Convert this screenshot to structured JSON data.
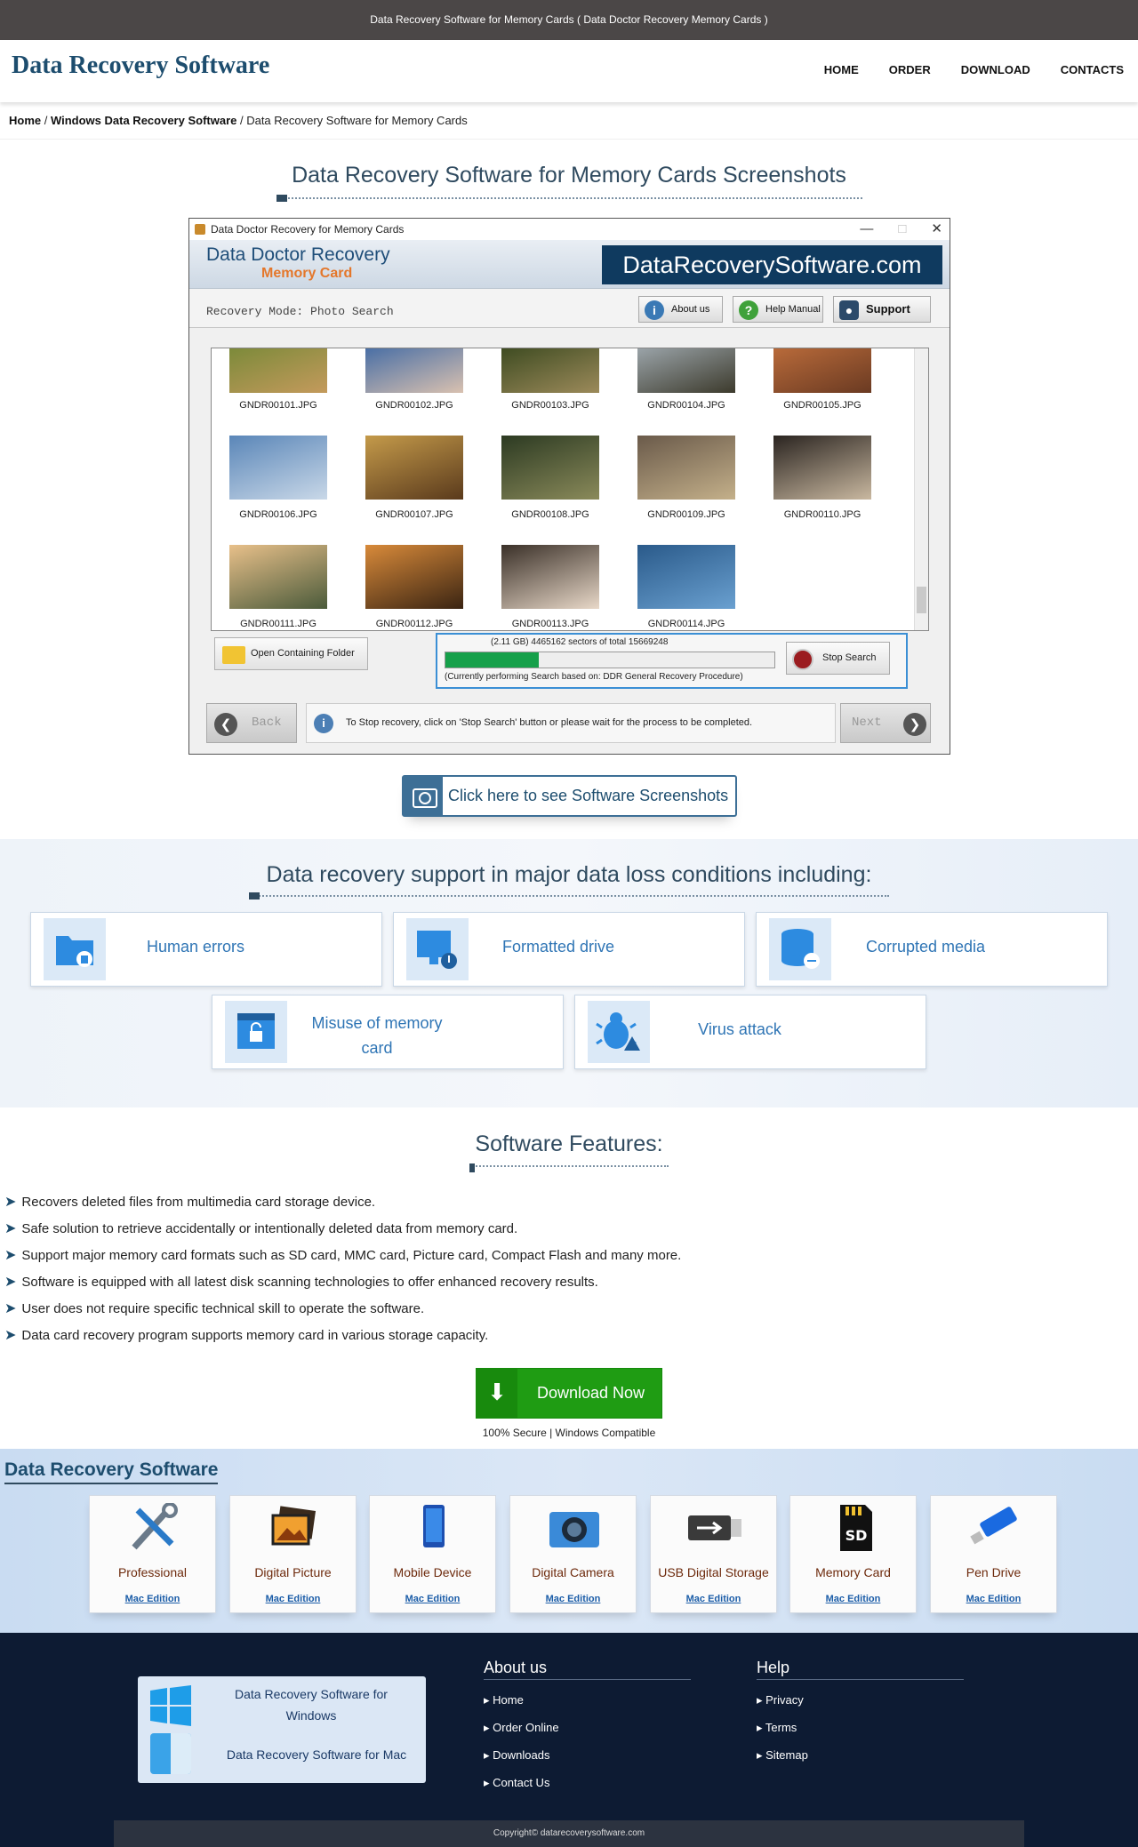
{
  "topbar": {
    "text": "Data Recovery Software for Memory Cards ( Data Doctor Recovery Memory Cards )"
  },
  "header": {
    "logo": "Data Recovery Software",
    "nav": [
      "HOME",
      "ORDER",
      "DOWNLOAD",
      "CONTACTS"
    ]
  },
  "breadcrumb": {
    "home": "Home",
    "sep": " / ",
    "parent": "Windows Data Recovery Software",
    "current": "Data Recovery Software for Memory Cards"
  },
  "screens": {
    "title": "Data Recovery Software for Memory Cards Screenshots",
    "button": "Click here to see Software Screenshots"
  },
  "app": {
    "window_title": "Data Doctor Recovery for Memory Cards",
    "banner_title": "Data Doctor Recovery",
    "banner_sub": "Memory Card",
    "brand": "DataRecoverySoftware.com",
    "mode": "Recovery Mode: Photo Search",
    "about": "About us",
    "help": "Help Manual",
    "support": "Support",
    "files": [
      "GNDR00101.JPG",
      "GNDR00102.JPG",
      "GNDR00103.JPG",
      "GNDR00104.JPG",
      "GNDR00105.JPG",
      "GNDR00106.JPG",
      "GNDR00107.JPG",
      "GNDR00108.JPG",
      "GNDR00109.JPG",
      "GNDR00110.JPG",
      "GNDR00111.JPG",
      "GNDR00112.JPG",
      "GNDR00113.JPG",
      "GNDR00114.JPG"
    ],
    "thumb_colors": [
      [
        "#7c8a3a",
        "#c49a5c"
      ],
      [
        "#4a6fa5",
        "#d9c1b0"
      ],
      [
        "#3f4c22",
        "#9c8a5a"
      ],
      [
        "#9aa3a8",
        "#3c3a2c"
      ],
      [
        "#b86a3a",
        "#6a3a22"
      ],
      [
        "#5a86b8",
        "#c9d8e8"
      ],
      [
        "#c49a4a",
        "#5a3a1c"
      ],
      [
        "#2c3a22",
        "#8a8a5a"
      ],
      [
        "#6a5a4a",
        "#c4b08a"
      ],
      [
        "#2a2420",
        "#c9b8a0"
      ],
      [
        "#e8c08a",
        "#4a5a3a"
      ],
      [
        "#d88a3a",
        "#3a2412"
      ],
      [
        "#3a3028",
        "#e8d8c8"
      ],
      [
        "#2a5a8a",
        "#6aa0d0"
      ]
    ],
    "open_folder": "Open Containing Folder",
    "progress_line1": "(2.11 GB) 4465162  sectors  of  total 15669248",
    "progress_line2": "(Currently performing Search based on:  DDR General Recovery Procedure)",
    "progress_fraction": 0.285,
    "stop": "Stop Search",
    "back": "Back",
    "next": "Next",
    "message": "To Stop recovery, click on 'Stop Search' button or please wait for the process to be completed."
  },
  "support": {
    "title": "Data recovery support in major data loss conditions including:",
    "cards": [
      "Human errors",
      "Formatted drive",
      "Corrupted media",
      "Misuse of memory card",
      "Virus attack"
    ]
  },
  "features": {
    "title": "Software Features:",
    "items": [
      "Recovers deleted files from multimedia card storage device.",
      "Safe solution to retrieve accidentally or intentionally deleted data from memory card.",
      "Support major memory card formats such as SD card, MMC card, Picture card, Compact Flash and many more.",
      "Software is equipped with all latest disk scanning technologies to offer enhanced recovery results.",
      "User does not require specific technical skill to operate the software.",
      "Data card recovery program supports memory card in various storage capacity."
    ]
  },
  "download": {
    "label": "Download Now",
    "sub": "100% Secure | Windows Compatible"
  },
  "products": {
    "title": "Data Recovery Software",
    "link": "Mac Edition",
    "items": [
      "Professional",
      "Digital Picture",
      "Mobile Device",
      "Digital Camera",
      "USB Digital Storage",
      "Memory Card",
      "Pen Drive"
    ]
  },
  "footer": {
    "windows": "Data Recovery Software for Windows",
    "mac": "Data Recovery Software for Mac",
    "about_title": "About us",
    "about_links": [
      "Home",
      "Order Online",
      "Downloads",
      "Contact Us"
    ],
    "help_title": "Help",
    "help_links": [
      "Privacy",
      "Terms",
      "Sitemap"
    ],
    "copyright": "Copyright© datarecoverysoftware.com"
  },
  "colors": {
    "accent": "#1d4d6e",
    "green": "#1f9c13",
    "progress": "#16a04a",
    "footer": "#0d1b33"
  }
}
